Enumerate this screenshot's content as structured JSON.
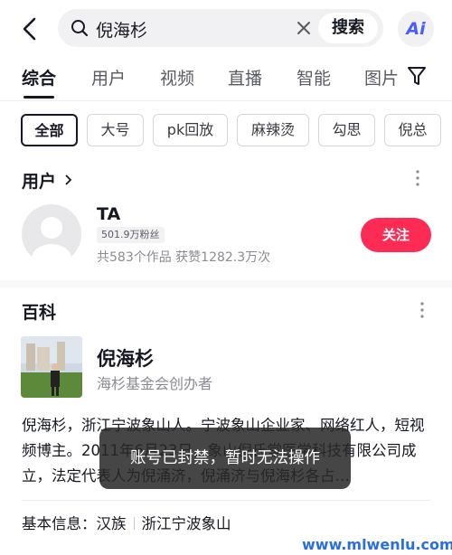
{
  "search": {
    "query": "倪海杉",
    "button_label": "搜索",
    "ai_label": "Ai"
  },
  "tabs": [
    {
      "label": "综合",
      "active": true
    },
    {
      "label": "用户",
      "active": false
    },
    {
      "label": "视频",
      "active": false
    },
    {
      "label": "直播",
      "active": false
    },
    {
      "label": "智能",
      "active": false
    },
    {
      "label": "图片",
      "active": false
    }
  ],
  "chips": [
    {
      "label": "全部",
      "active": true
    },
    {
      "label": "大号",
      "active": false
    },
    {
      "label": "pk回放",
      "active": false
    },
    {
      "label": "麻辣烫",
      "active": false
    },
    {
      "label": "勾思",
      "active": false
    },
    {
      "label": "倪总",
      "active": false
    }
  ],
  "users_section": {
    "title": "用户",
    "user": {
      "name": "TA",
      "fans": "501.9万粉丝",
      "stats": "共583个作品 获赞1282.3万次",
      "follow_label": "关注"
    }
  },
  "wiki": {
    "title": "百科",
    "name": "倪海杉",
    "subtitle": "海杉基金会创办者",
    "description": "倪海杉，浙江宁波象山人。宁波象山企业家、网络红人，短视频博主。2011年6月23日，象山倪氏堂医学科技有限公司成立，法定代表人为倪涌济，倪涌济与倪海杉各占…",
    "basic_label": "基本信息：",
    "basic_items": [
      "汉族",
      "浙江宁波象山"
    ]
  },
  "toast": "账号已封禁，暂时无法操作",
  "watermark": "www.mlwenlu.com",
  "colors": {
    "accent": "#fe2c55",
    "text": "#161823",
    "secondary": "#8a8b91"
  }
}
